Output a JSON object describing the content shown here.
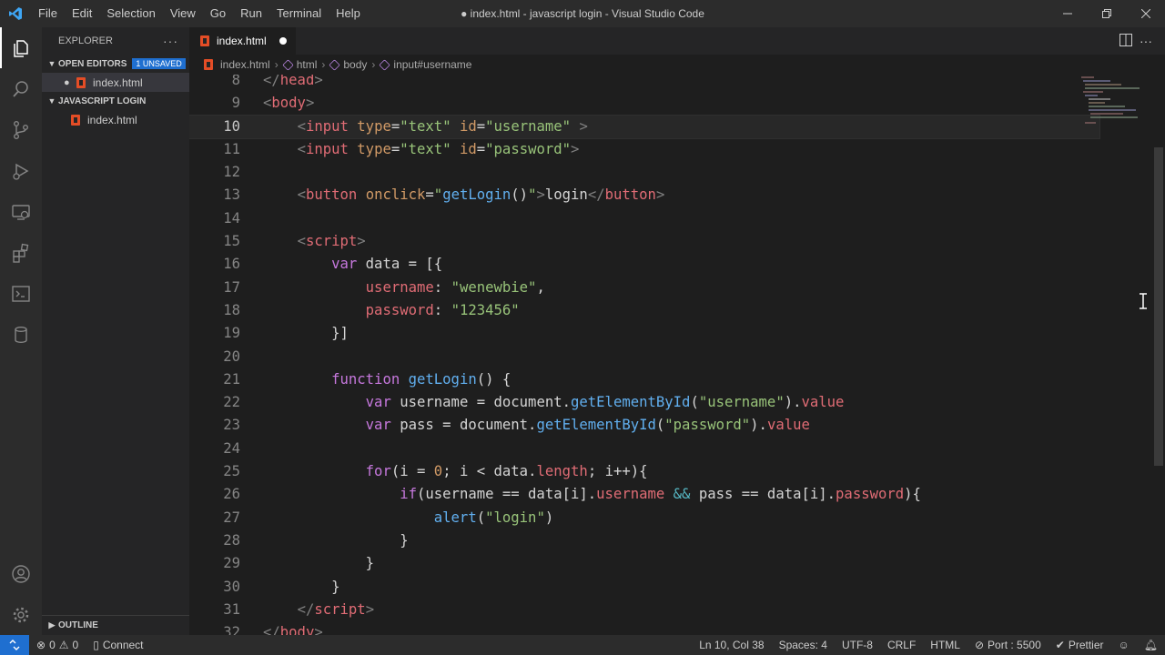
{
  "window": {
    "title": "● index.html - javascript login - Visual Studio Code",
    "menu": [
      "File",
      "Edit",
      "Selection",
      "View",
      "Go",
      "Run",
      "Terminal",
      "Help"
    ]
  },
  "sidebar": {
    "header": "EXPLORER",
    "open_editors_title": "OPEN EDITORS",
    "unsaved_badge": "1 UNSAVED",
    "open_editor_file": "index.html",
    "folder_title": "JAVASCRIPT LOGIN",
    "folder_file": "index.html",
    "outline_title": "OUTLINE"
  },
  "tabs": [
    {
      "label": "index.html",
      "modified": true
    }
  ],
  "breadcrumb": [
    "index.html",
    "html",
    "body",
    "input#username"
  ],
  "editor": {
    "current_line": 10,
    "lines": [
      {
        "n": "8",
        "tokens": [
          [
            "t-tag",
            "</"
          ],
          [
            "t-name",
            "head"
          ],
          [
            "t-tag",
            ">"
          ]
        ]
      },
      {
        "n": "9",
        "tokens": [
          [
            "t-tag",
            "<"
          ],
          [
            "t-name",
            "body"
          ],
          [
            "t-tag",
            ">"
          ]
        ]
      },
      {
        "n": "10",
        "tokens": [
          [
            "t-plain",
            "    "
          ],
          [
            "t-tag",
            "<"
          ],
          [
            "t-name",
            "input"
          ],
          [
            "t-plain",
            " "
          ],
          [
            "t-attr",
            "type"
          ],
          [
            "t-plain",
            "="
          ],
          [
            "t-str",
            "\"text\""
          ],
          [
            "t-plain",
            " "
          ],
          [
            "t-attr",
            "id"
          ],
          [
            "t-plain",
            "="
          ],
          [
            "t-str",
            "\"username\""
          ],
          [
            "t-plain",
            " "
          ],
          [
            "t-tag",
            ">"
          ]
        ]
      },
      {
        "n": "11",
        "tokens": [
          [
            "t-plain",
            "    "
          ],
          [
            "t-tag",
            "<"
          ],
          [
            "t-name",
            "input"
          ],
          [
            "t-plain",
            " "
          ],
          [
            "t-attr",
            "type"
          ],
          [
            "t-plain",
            "="
          ],
          [
            "t-str",
            "\"text\""
          ],
          [
            "t-plain",
            " "
          ],
          [
            "t-attr",
            "id"
          ],
          [
            "t-plain",
            "="
          ],
          [
            "t-str",
            "\"password\""
          ],
          [
            "t-tag",
            ">"
          ]
        ]
      },
      {
        "n": "12",
        "tokens": []
      },
      {
        "n": "13",
        "tokens": [
          [
            "t-plain",
            "    "
          ],
          [
            "t-tag",
            "<"
          ],
          [
            "t-name",
            "button"
          ],
          [
            "t-plain",
            " "
          ],
          [
            "t-attr",
            "onclick"
          ],
          [
            "t-plain",
            "="
          ],
          [
            "t-str",
            "\""
          ],
          [
            "t-fn",
            "getLogin"
          ],
          [
            "t-plain",
            "()"
          ],
          [
            "t-str",
            "\""
          ],
          [
            "t-tag",
            ">"
          ],
          [
            "t-plain",
            "login"
          ],
          [
            "t-tag",
            "</"
          ],
          [
            "t-name",
            "button"
          ],
          [
            "t-tag",
            ">"
          ]
        ]
      },
      {
        "n": "14",
        "tokens": []
      },
      {
        "n": "15",
        "tokens": [
          [
            "t-plain",
            "    "
          ],
          [
            "t-tag",
            "<"
          ],
          [
            "t-name",
            "script"
          ],
          [
            "t-tag",
            ">"
          ]
        ]
      },
      {
        "n": "16",
        "tokens": [
          [
            "t-plain",
            "        "
          ],
          [
            "t-kw",
            "var"
          ],
          [
            "t-plain",
            " data = [{"
          ]
        ]
      },
      {
        "n": "17",
        "tokens": [
          [
            "t-plain",
            "            "
          ],
          [
            "t-prop",
            "username"
          ],
          [
            "t-plain",
            ": "
          ],
          [
            "t-str",
            "\"wenewbie\""
          ],
          [
            "t-plain",
            ","
          ]
        ]
      },
      {
        "n": "18",
        "tokens": [
          [
            "t-plain",
            "            "
          ],
          [
            "t-prop",
            "password"
          ],
          [
            "t-plain",
            ": "
          ],
          [
            "t-str",
            "\"123456\""
          ]
        ]
      },
      {
        "n": "19",
        "tokens": [
          [
            "t-plain",
            "        }]"
          ]
        ]
      },
      {
        "n": "20",
        "tokens": []
      },
      {
        "n": "21",
        "tokens": [
          [
            "t-plain",
            "        "
          ],
          [
            "t-kw",
            "function"
          ],
          [
            "t-plain",
            " "
          ],
          [
            "t-fn",
            "getLogin"
          ],
          [
            "t-plain",
            "() {"
          ]
        ]
      },
      {
        "n": "22",
        "tokens": [
          [
            "t-plain",
            "            "
          ],
          [
            "t-kw",
            "var"
          ],
          [
            "t-plain",
            " username = document."
          ],
          [
            "t-fn",
            "getElementById"
          ],
          [
            "t-plain",
            "("
          ],
          [
            "t-str",
            "\"username\""
          ],
          [
            "t-plain",
            ")."
          ],
          [
            "t-prop",
            "value"
          ]
        ]
      },
      {
        "n": "23",
        "tokens": [
          [
            "t-plain",
            "            "
          ],
          [
            "t-kw",
            "var"
          ],
          [
            "t-plain",
            " pass = document."
          ],
          [
            "t-fn",
            "getElementById"
          ],
          [
            "t-plain",
            "("
          ],
          [
            "t-str",
            "\"password\""
          ],
          [
            "t-plain",
            ")."
          ],
          [
            "t-prop",
            "value"
          ]
        ]
      },
      {
        "n": "24",
        "tokens": []
      },
      {
        "n": "25",
        "tokens": [
          [
            "t-plain",
            "            "
          ],
          [
            "t-kw",
            "for"
          ],
          [
            "t-plain",
            "(i = "
          ],
          [
            "t-num",
            "0"
          ],
          [
            "t-plain",
            "; i < data."
          ],
          [
            "t-prop",
            "length"
          ],
          [
            "t-plain",
            "; i++){"
          ]
        ]
      },
      {
        "n": "26",
        "tokens": [
          [
            "t-plain",
            "                "
          ],
          [
            "t-kw",
            "if"
          ],
          [
            "t-plain",
            "(username == data[i]."
          ],
          [
            "t-prop",
            "username"
          ],
          [
            "t-plain",
            " "
          ],
          [
            "t-op",
            "&&"
          ],
          [
            "t-plain",
            " pass == data[i]."
          ],
          [
            "t-prop",
            "password"
          ],
          [
            "t-plain",
            "){"
          ]
        ]
      },
      {
        "n": "27",
        "tokens": [
          [
            "t-plain",
            "                    "
          ],
          [
            "t-fn",
            "alert"
          ],
          [
            "t-plain",
            "("
          ],
          [
            "t-str",
            "\"login\""
          ],
          [
            "t-plain",
            ")"
          ]
        ]
      },
      {
        "n": "28",
        "tokens": [
          [
            "t-plain",
            "                }"
          ]
        ]
      },
      {
        "n": "29",
        "tokens": [
          [
            "t-plain",
            "            }"
          ]
        ]
      },
      {
        "n": "30",
        "tokens": [
          [
            "t-plain",
            "        }"
          ]
        ]
      },
      {
        "n": "31",
        "tokens": [
          [
            "t-plain",
            "    "
          ],
          [
            "t-tag",
            "</"
          ],
          [
            "t-name",
            "script"
          ],
          [
            "t-tag",
            ">"
          ]
        ]
      },
      {
        "n": "32",
        "tokens": [
          [
            "t-tag",
            "</"
          ],
          [
            "t-name",
            "body"
          ],
          [
            "t-tag",
            ">"
          ]
        ]
      }
    ]
  },
  "statusbar": {
    "errors": "0",
    "warnings": "0",
    "connect": "Connect",
    "position": "Ln 10, Col 38",
    "spaces": "Spaces: 4",
    "encoding": "UTF-8",
    "eol": "CRLF",
    "language": "HTML",
    "port": "Port : 5500",
    "prettier": "Prettier"
  },
  "colors": {
    "accent": "#1f6fd0",
    "html_icon": "#e44d26"
  },
  "icons": [
    "vscode-logo-icon",
    "explorer-icon",
    "search-icon",
    "source-control-icon",
    "run-debug-icon",
    "remote-explorer-icon",
    "extensions-icon",
    "terminal-icon",
    "database-icon",
    "account-icon",
    "settings-gear-icon"
  ]
}
